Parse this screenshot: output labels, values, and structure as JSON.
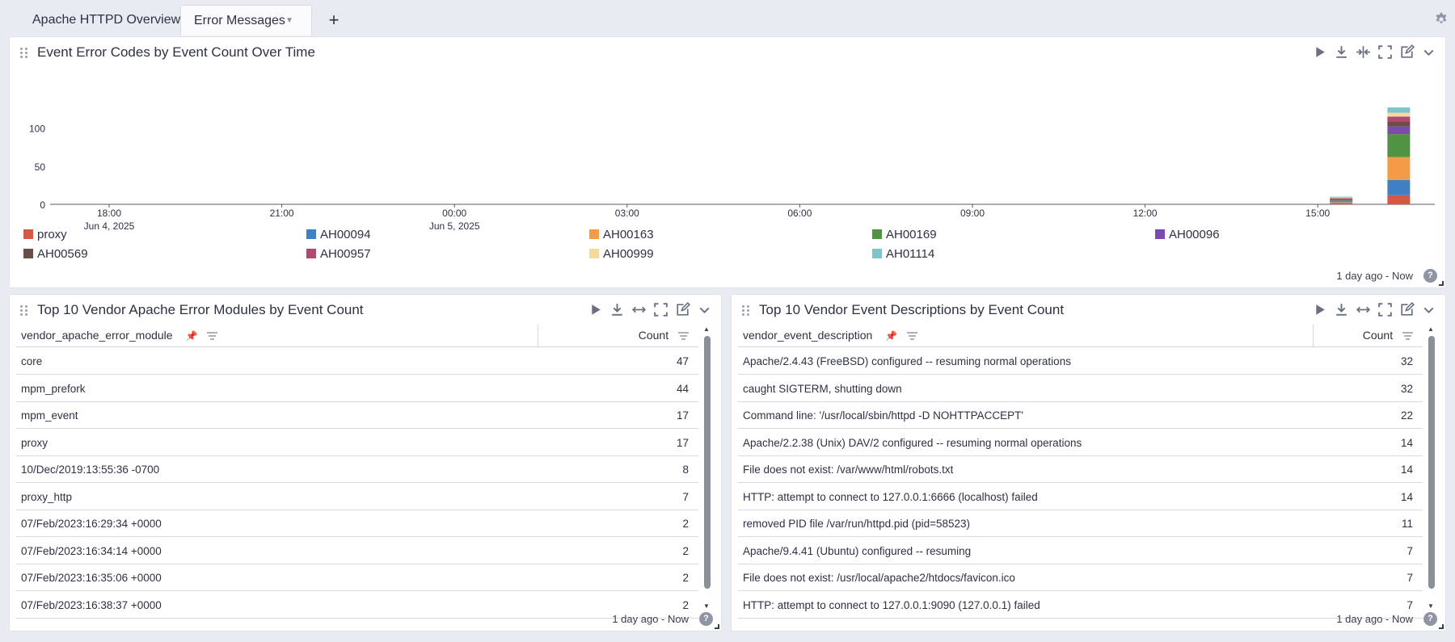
{
  "tabs": [
    {
      "label": "Apache HTTPD Overview"
    },
    {
      "label": "Error Messages"
    }
  ],
  "icons": {
    "add_tab": "+",
    "settings": "gear-icon",
    "dropdown": "caret-down-icon"
  },
  "colors": {
    "proxy": "#d65745",
    "AH00094": "#3f7fc4",
    "AH00163": "#f49b47",
    "AH00169": "#4f9343",
    "AH00096": "#7b4bb0",
    "AH00569": "#6b4f47",
    "AH00957": "#b0486f",
    "AH00999": "#f8d99c",
    "AH01114": "#7fc3cc"
  },
  "top_panel": {
    "title": "Event Error Codes by Event Count Over Time",
    "timerange": "1 day ago - Now",
    "help": "?"
  },
  "chart_data": {
    "type": "bar",
    "stacked": true,
    "y_ticks": [
      "0",
      "50",
      "100"
    ],
    "ylim": [
      0,
      130
    ],
    "x_ticks": [
      {
        "time": "18:00",
        "date": "Jun 4, 2025"
      },
      {
        "time": "21:00",
        "date": ""
      },
      {
        "time": "00:00",
        "date": "Jun 5, 2025"
      },
      {
        "time": "03:00",
        "date": ""
      },
      {
        "time": "06:00",
        "date": ""
      },
      {
        "time": "09:00",
        "date": ""
      },
      {
        "time": "12:00",
        "date": ""
      },
      {
        "time": "15:00",
        "date": ""
      }
    ],
    "series_names": [
      "proxy",
      "AH00094",
      "AH00163",
      "AH00169",
      "AH00096",
      "AH00569",
      "AH00957",
      "AH00999",
      "AH01114"
    ],
    "buckets": [
      {
        "time": "15:00",
        "values": [
          1,
          1,
          1,
          2,
          1,
          1,
          1,
          1,
          1
        ]
      },
      {
        "time": "16:00",
        "values": [
          12,
          20,
          30,
          30,
          10,
          6,
          7,
          5,
          7
        ]
      }
    ],
    "legend_position": "bottom",
    "grid": false
  },
  "left_panel": {
    "title": "Top 10 Vendor Apache Error Modules by Event Count",
    "col1": "vendor_apache_error_module",
    "col2": "Count",
    "timerange": "1 day ago - Now",
    "help": "?",
    "rows": [
      {
        "name": "core",
        "count": "47"
      },
      {
        "name": "mpm_prefork",
        "count": "44"
      },
      {
        "name": "mpm_event",
        "count": "17"
      },
      {
        "name": "proxy",
        "count": "17"
      },
      {
        "name": "10/Dec/2019:13:55:36 -0700",
        "count": "8"
      },
      {
        "name": "proxy_http",
        "count": "7"
      },
      {
        "name": "07/Feb/2023:16:29:34 +0000",
        "count": "2"
      },
      {
        "name": "07/Feb/2023:16:34:14 +0000",
        "count": "2"
      },
      {
        "name": "07/Feb/2023:16:35:06 +0000",
        "count": "2"
      },
      {
        "name": "07/Feb/2023:16:38:37 +0000",
        "count": "2"
      }
    ]
  },
  "right_panel": {
    "title": "Top 10 Vendor Event Descriptions by Event Count",
    "col1": "vendor_event_description",
    "col2": "Count",
    "timerange": "1 day ago - Now",
    "help": "?",
    "rows": [
      {
        "name": "Apache/2.4.43 (FreeBSD) configured -- resuming normal operations",
        "count": "32"
      },
      {
        "name": "caught SIGTERM, shutting down",
        "count": "32"
      },
      {
        "name": "Command line: '/usr/local/sbin/httpd -D NOHTTPACCEPT'",
        "count": "22"
      },
      {
        "name": "Apache/2.2.38 (Unix) DAV/2 configured -- resuming normal operations",
        "count": "14"
      },
      {
        "name": "File does not exist: /var/www/html/robots.txt",
        "count": "14"
      },
      {
        "name": "HTTP: attempt to connect to 127.0.0.1:6666 (localhost) failed",
        "count": "14"
      },
      {
        "name": "removed PID file /var/run/httpd.pid (pid=58523)",
        "count": "11"
      },
      {
        "name": "Apache/9.4.41 (Ubuntu) configured -- resuming",
        "count": "7"
      },
      {
        "name": "File does not exist: /usr/local/apache2/htdocs/favicon.ico",
        "count": "7"
      },
      {
        "name": "HTTP: attempt to connect to 127.0.0.1:9090 (127.0.0.1) failed",
        "count": "7"
      }
    ]
  }
}
